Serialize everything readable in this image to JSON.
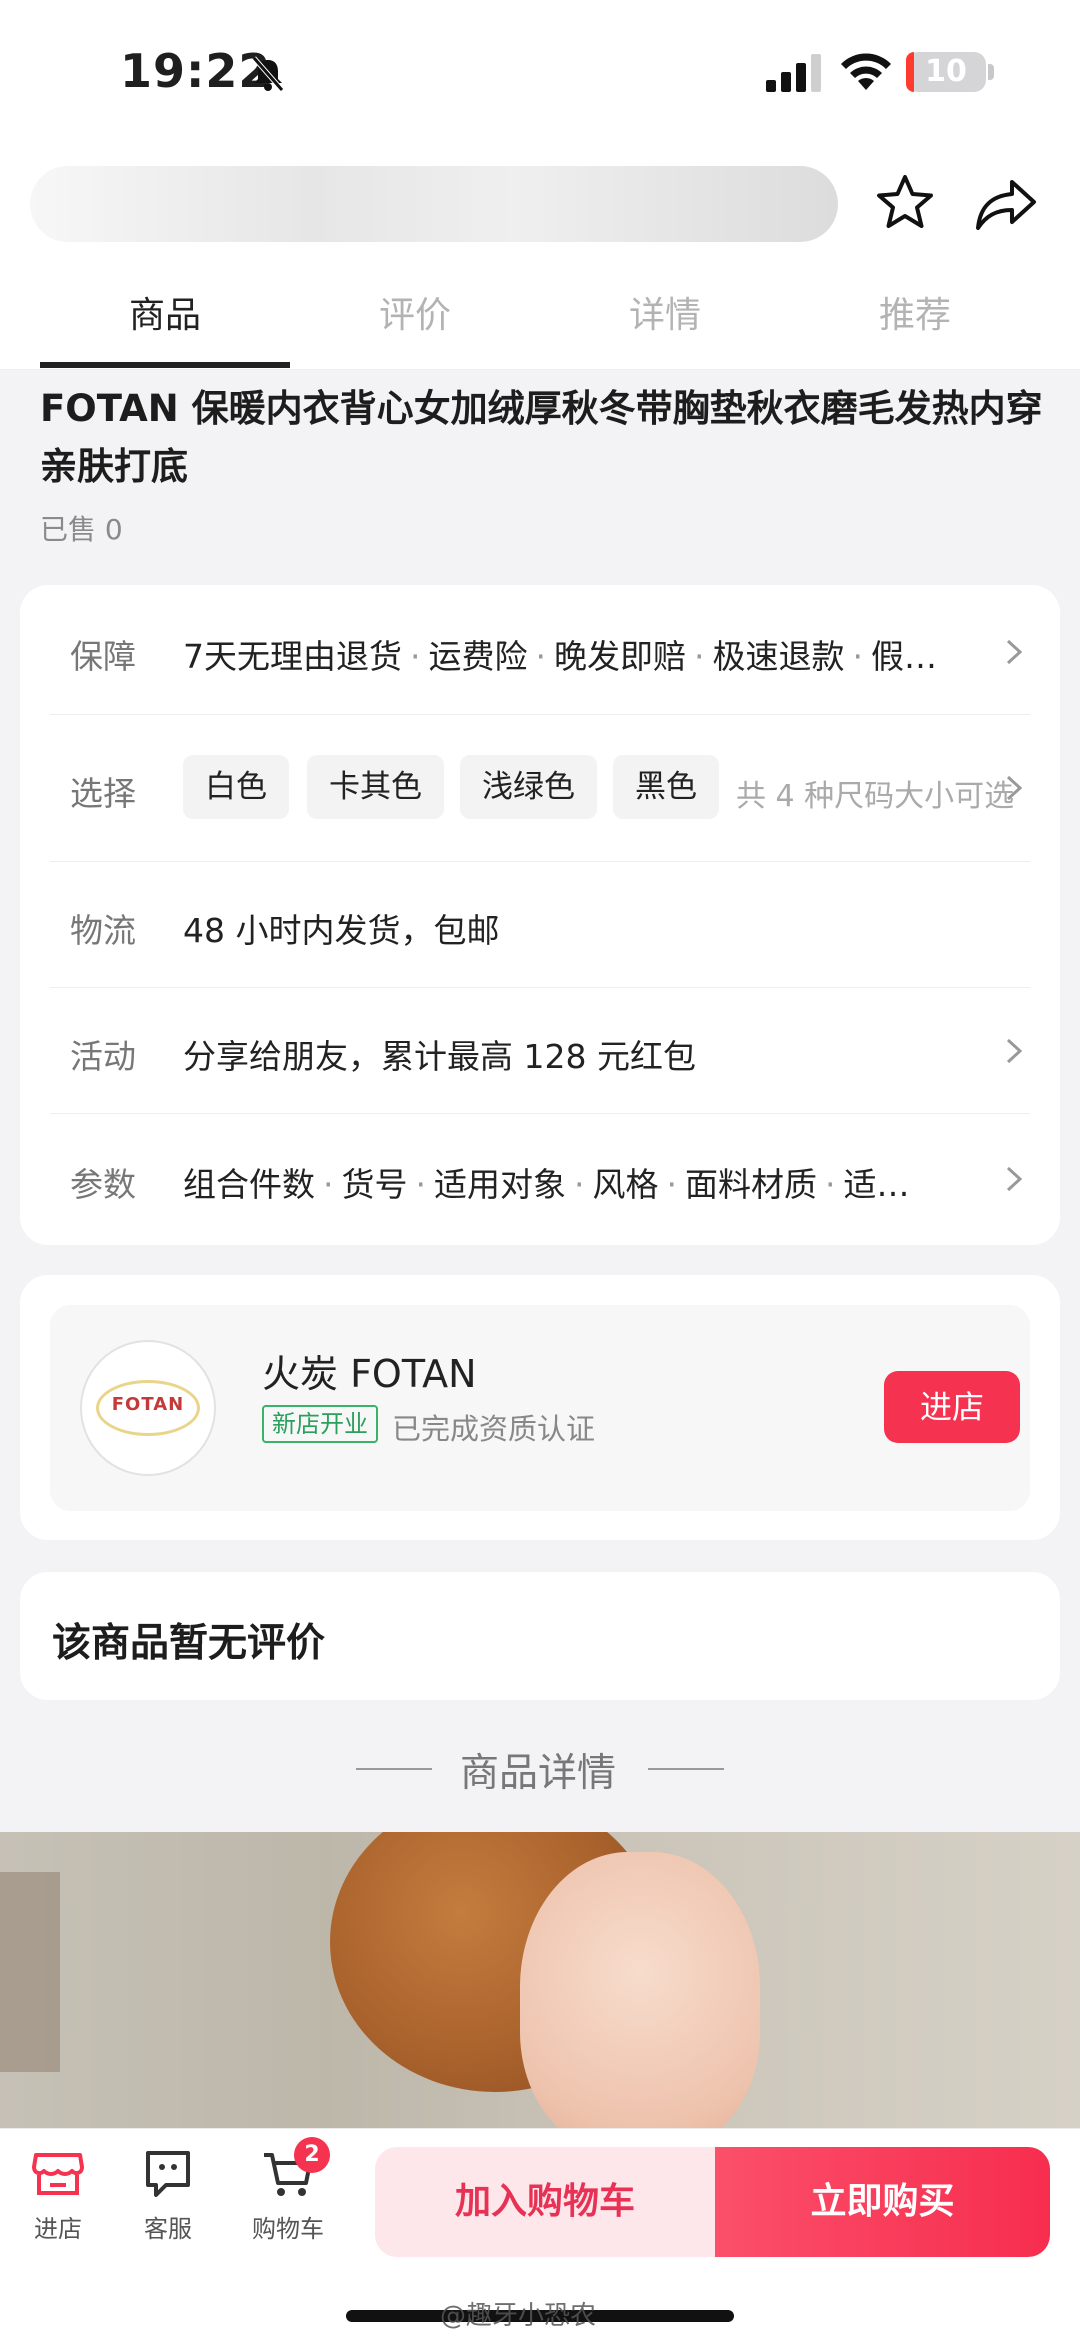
{
  "status_bar": {
    "time": "19:22",
    "battery": "10",
    "battery_level": 0.1
  },
  "tabs": [
    {
      "label": "商品",
      "active": true
    },
    {
      "label": "评价",
      "active": false
    },
    {
      "label": "详情",
      "active": false
    },
    {
      "label": "推荐",
      "active": false
    }
  ],
  "product": {
    "title": "FOTAN 保暖内衣背心女加绒厚秋冬带胸垫秋衣磨毛发热内穿亲肤打底",
    "sold": "已售 0"
  },
  "info": {
    "guarantee": {
      "label": "保障",
      "items": [
        "7天无理由退货",
        "运费险",
        "晚发即赔",
        "极速退款",
        "假…"
      ]
    },
    "select": {
      "label": "选择",
      "colors": [
        "白色",
        "卡其色",
        "浅绿色",
        "黑色"
      ],
      "note": "共 4 种尺码大小可选"
    },
    "shipping": {
      "label": "物流",
      "value": "48 小时内发货，包邮"
    },
    "activity": {
      "label": "活动",
      "value": "分享给朋友，累计最高 128 元红包"
    },
    "params": {
      "label": "参数",
      "items": [
        "组合件数",
        "货号",
        "适用对象",
        "风格",
        "面料材质",
        "适…"
      ]
    }
  },
  "store": {
    "name": "火炭 FOTAN",
    "logo_text": "FOTAN",
    "badge": "新店开业",
    "verified": "已完成资质认证",
    "enter_label": "进店"
  },
  "reviews": {
    "empty_text": "该商品暂无评价"
  },
  "detail_header": "商品详情",
  "bottom_bar": {
    "store": "进店",
    "service": "客服",
    "cart": "购物车",
    "cart_count": "2",
    "add_to_cart": "加入购物车",
    "buy_now": "立即购买"
  },
  "watermark": "@趣牙小恐农",
  "colors": {
    "accent": "#f5324f",
    "badge_green": "#2aa05c",
    "add_cart_bg": "#fde7eb"
  },
  "icons": [
    "bell-muted-icon",
    "signal-icon",
    "wifi-icon",
    "battery-icon",
    "star-icon",
    "share-icon",
    "chevron-right-icon",
    "store-icon",
    "service-icon",
    "cart-icon"
  ]
}
